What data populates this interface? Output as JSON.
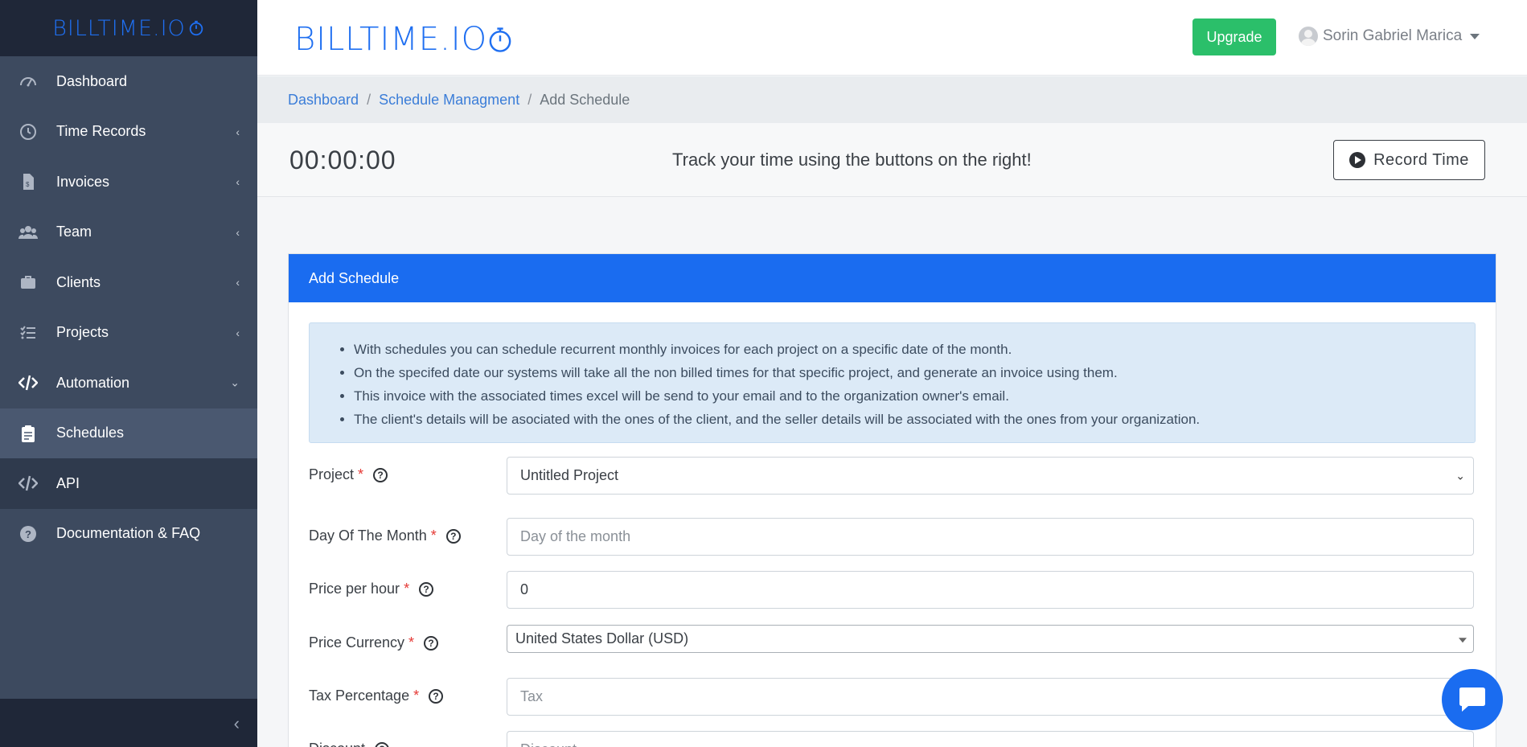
{
  "brand": {
    "name": "BILLTIME.IO"
  },
  "sidebar": {
    "items": [
      {
        "label": "Dashboard",
        "icon": "dashboard-icon",
        "has_chevron": false
      },
      {
        "label": "Time Records",
        "icon": "clock-icon",
        "has_chevron": true
      },
      {
        "label": "Invoices",
        "icon": "invoice-icon",
        "has_chevron": true
      },
      {
        "label": "Team",
        "icon": "users-icon",
        "has_chevron": true
      },
      {
        "label": "Clients",
        "icon": "briefcase-icon",
        "has_chevron": true
      },
      {
        "label": "Projects",
        "icon": "tasks-icon",
        "has_chevron": true
      },
      {
        "label": "Automation",
        "icon": "code-icon",
        "has_chevron": true,
        "expanded": true
      },
      {
        "label": "Schedules",
        "icon": "clipboard-icon",
        "has_chevron": false,
        "active": true
      },
      {
        "label": "API",
        "icon": "code-icon",
        "has_chevron": false
      },
      {
        "label": "Documentation & FAQ",
        "icon": "question-circle-icon",
        "has_chevron": false
      }
    ]
  },
  "header": {
    "upgrade_label": "Upgrade",
    "user_name": "Sorin Gabriel Marica"
  },
  "breadcrumb": {
    "items": [
      "Dashboard",
      "Schedule Managment",
      "Add Schedule"
    ]
  },
  "timer": {
    "time": "00:00:00",
    "message": "Track your time using the buttons on the right!",
    "record_label": "Record Time"
  },
  "card": {
    "title": "Add Schedule",
    "info": [
      "With schedules you can schedule recurrent monthly invoices for each project on a specific date of the month.",
      "On the specifed date our systems will take all the non billed times for that specific project, and generate an invoice using them.",
      "This invoice with the associated times excel will be send to your email and to the organization owner's email.",
      "The client's details will be asociated with the ones of the client, and the seller details will be associated with the ones from your organization."
    ],
    "fields": {
      "project": {
        "label": "Project",
        "value": "Untitled Project"
      },
      "day": {
        "label": "Day Of The Month",
        "placeholder": "Day of the month"
      },
      "price": {
        "label": "Price per hour",
        "value": "0"
      },
      "currency": {
        "label": "Price Currency",
        "value": "United States Dollar (USD)"
      },
      "tax": {
        "label": "Tax Percentage",
        "placeholder": "Tax"
      },
      "discount": {
        "label": "Discount",
        "placeholder": "Discount"
      }
    }
  },
  "colors": {
    "brand_blue": "#1a6cf0",
    "upgrade_green": "#2bbf6a",
    "sidebar_bg": "#3d4a5f",
    "sidebar_dark": "#1f2738"
  }
}
